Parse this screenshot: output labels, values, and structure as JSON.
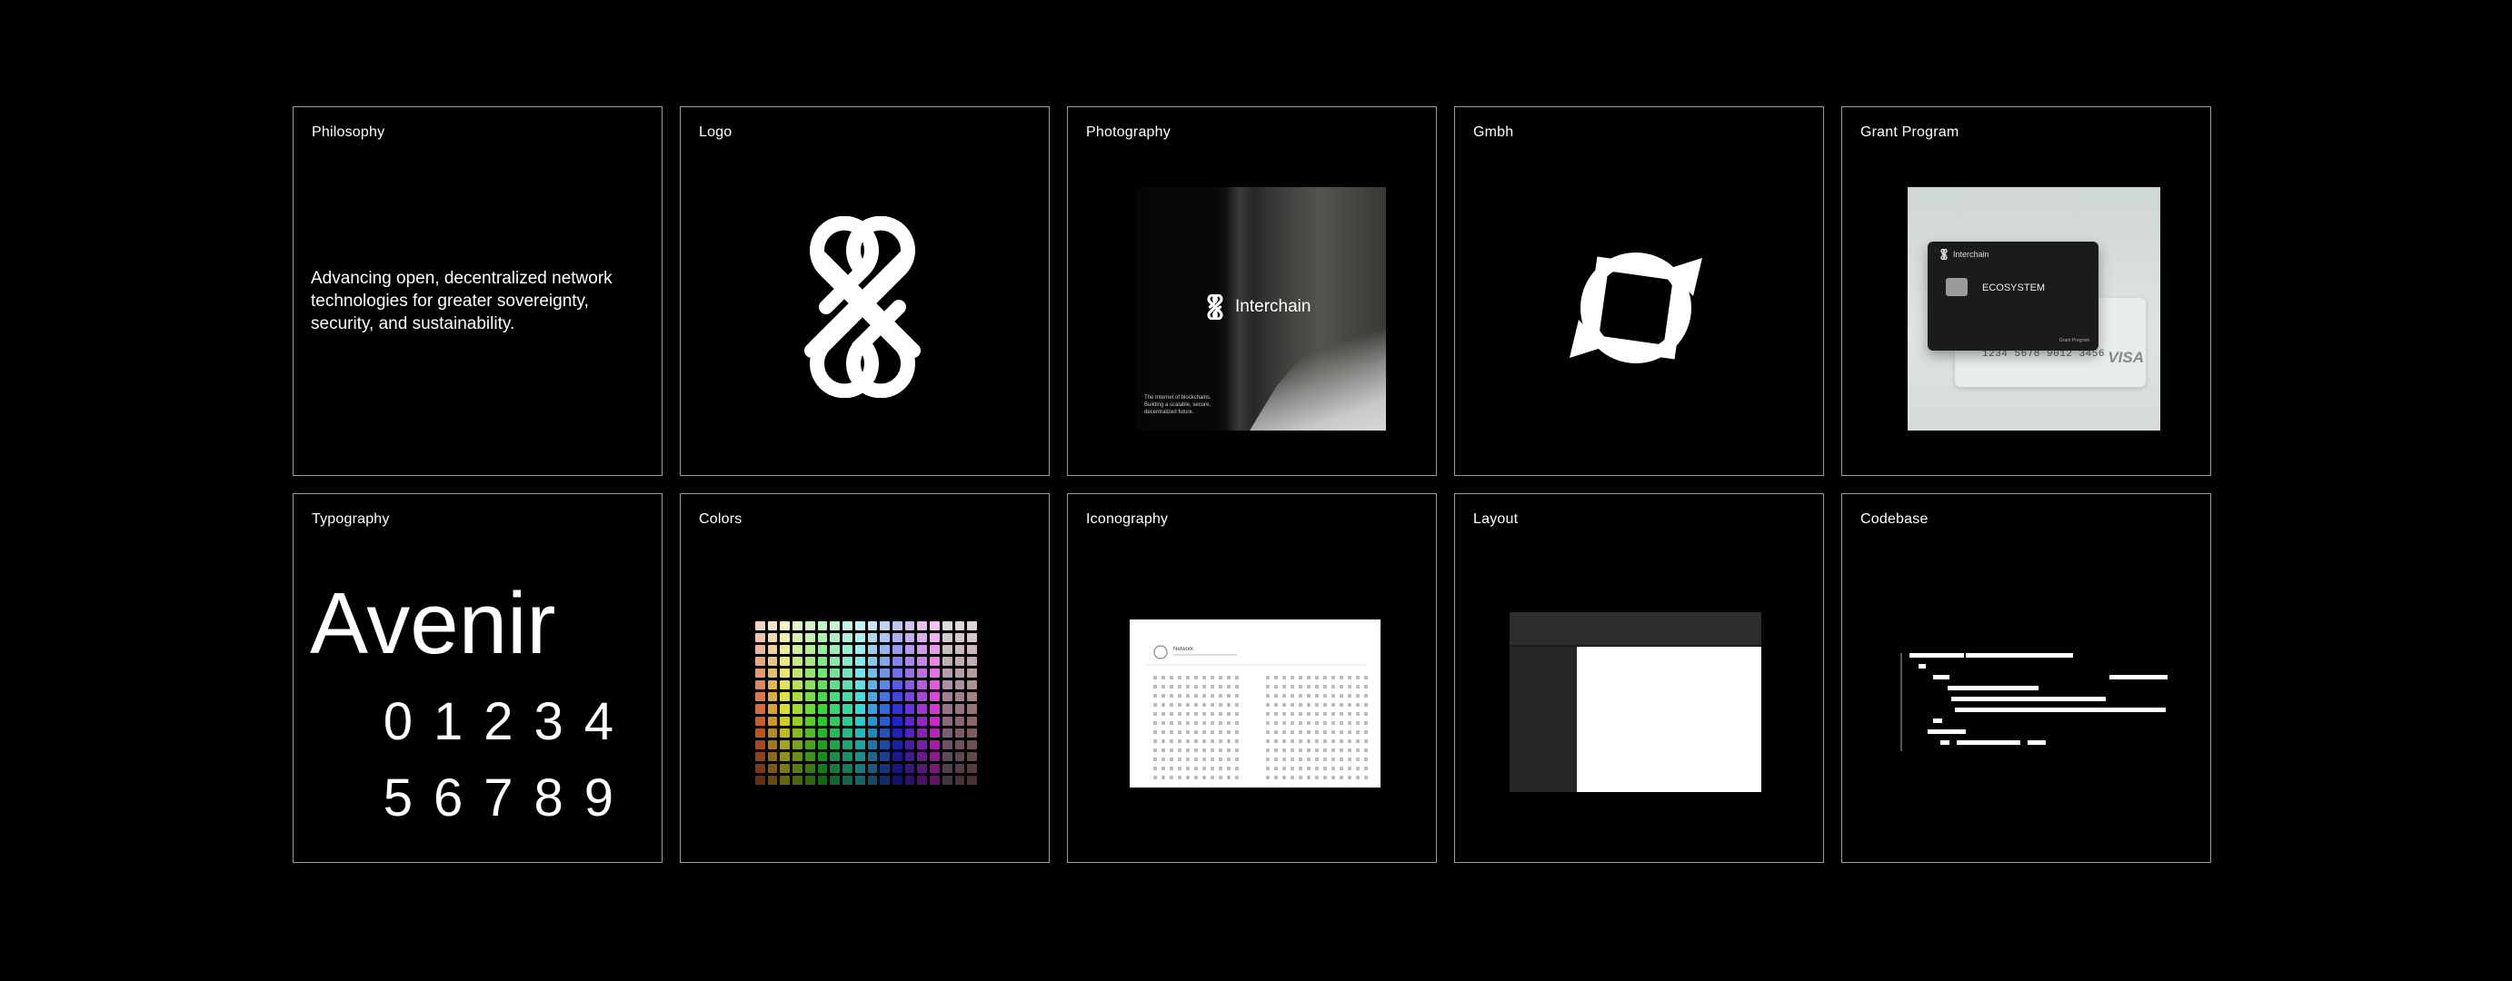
{
  "cards": [
    {
      "title": "Philosophy",
      "text": "Advancing open, decentralized network technologies for greater sovereignty, security, and sustainability."
    },
    {
      "title": "Logo"
    },
    {
      "title": "Photography",
      "brand": "Interchain",
      "caption": "The Internet of blockchains. Building a scalable, secure, decentralized future."
    },
    {
      "title": "Gmbh"
    },
    {
      "title": "Grant Program",
      "card_brand": "Interchain",
      "card_label": "ECOSYSTEM",
      "card_number": "1234 5678 9012 3456",
      "card_network": "VISA",
      "card_small": "Grant Program"
    },
    {
      "title": "Typography",
      "font_name": "Avenir",
      "digits_row1": "01234",
      "digits_row2": "56789"
    },
    {
      "title": "Colors"
    },
    {
      "title": "Iconography",
      "sheet_title": "Network"
    },
    {
      "title": "Layout"
    },
    {
      "title": "Codebase"
    }
  ],
  "colors": {
    "background": "#000000",
    "card_border": "#9c9c9c",
    "text": "#ffffff"
  },
  "icons": [
    "interchain-logo-icon",
    "gmbh-logo-icon",
    "shield-icon"
  ]
}
